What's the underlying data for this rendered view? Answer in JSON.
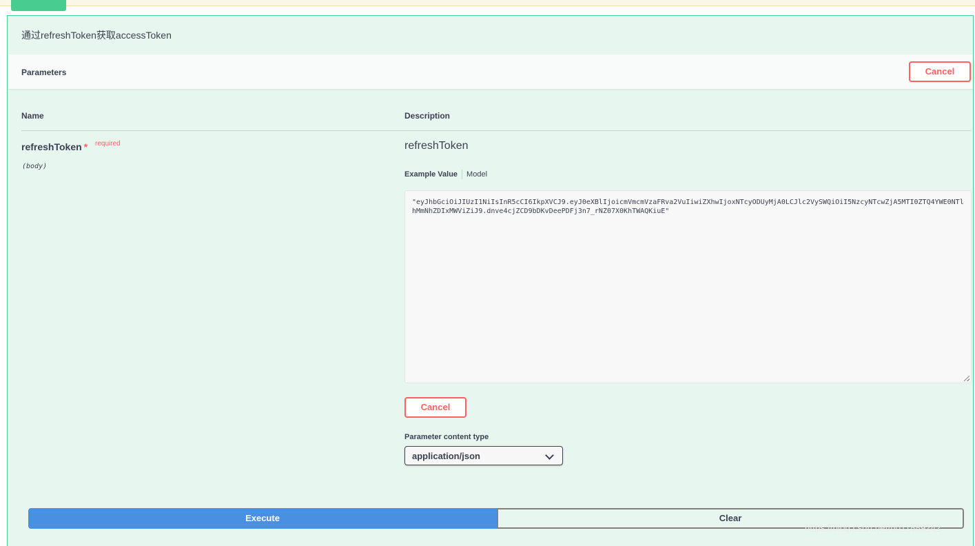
{
  "operation": {
    "summary_description": "通过refreshToken获取accessToken"
  },
  "parameters_section": {
    "title": "Parameters",
    "cancel_label": "Cancel",
    "column_name": "Name",
    "column_description": "Description"
  },
  "parameter": {
    "name": "refreshToken",
    "required_mark": "*",
    "required_label": "required",
    "location": "(body)",
    "description": "refreshToken",
    "tabs": {
      "example_value": "Example Value",
      "model": "Model"
    },
    "body_value": "\"eyJhbGciOiJIUzI1NiIsInR5cCI6IkpXVCJ9.eyJ0eXBlIjoicmVmcmVzaFRva2VuIiwiZXhwIjoxNTcyODUyMjA0LCJlc2VySWQiOiI5NzcyNTcwZjA5MTI0ZTQ4YWE0NTlhMmNhZDIxMWViZiJ9.dnve4cjZCD9bDKvDeePDFj3n7_rNZ07X0KhTWAQKiuE\"",
    "cancel_label": "Cancel",
    "content_type_label": "Parameter content type",
    "content_type_value": "application/json"
  },
  "actions": {
    "execute_label": "Execute",
    "clear_label": "Clear"
  },
  "watermark": "https://blog.csdn.net/u011889242",
  "colors": {
    "post_accent": "#49cc90",
    "panel_bg": "#e8f6f0",
    "cancel_red": "#ff6060",
    "execute_blue": "#4990e2"
  }
}
